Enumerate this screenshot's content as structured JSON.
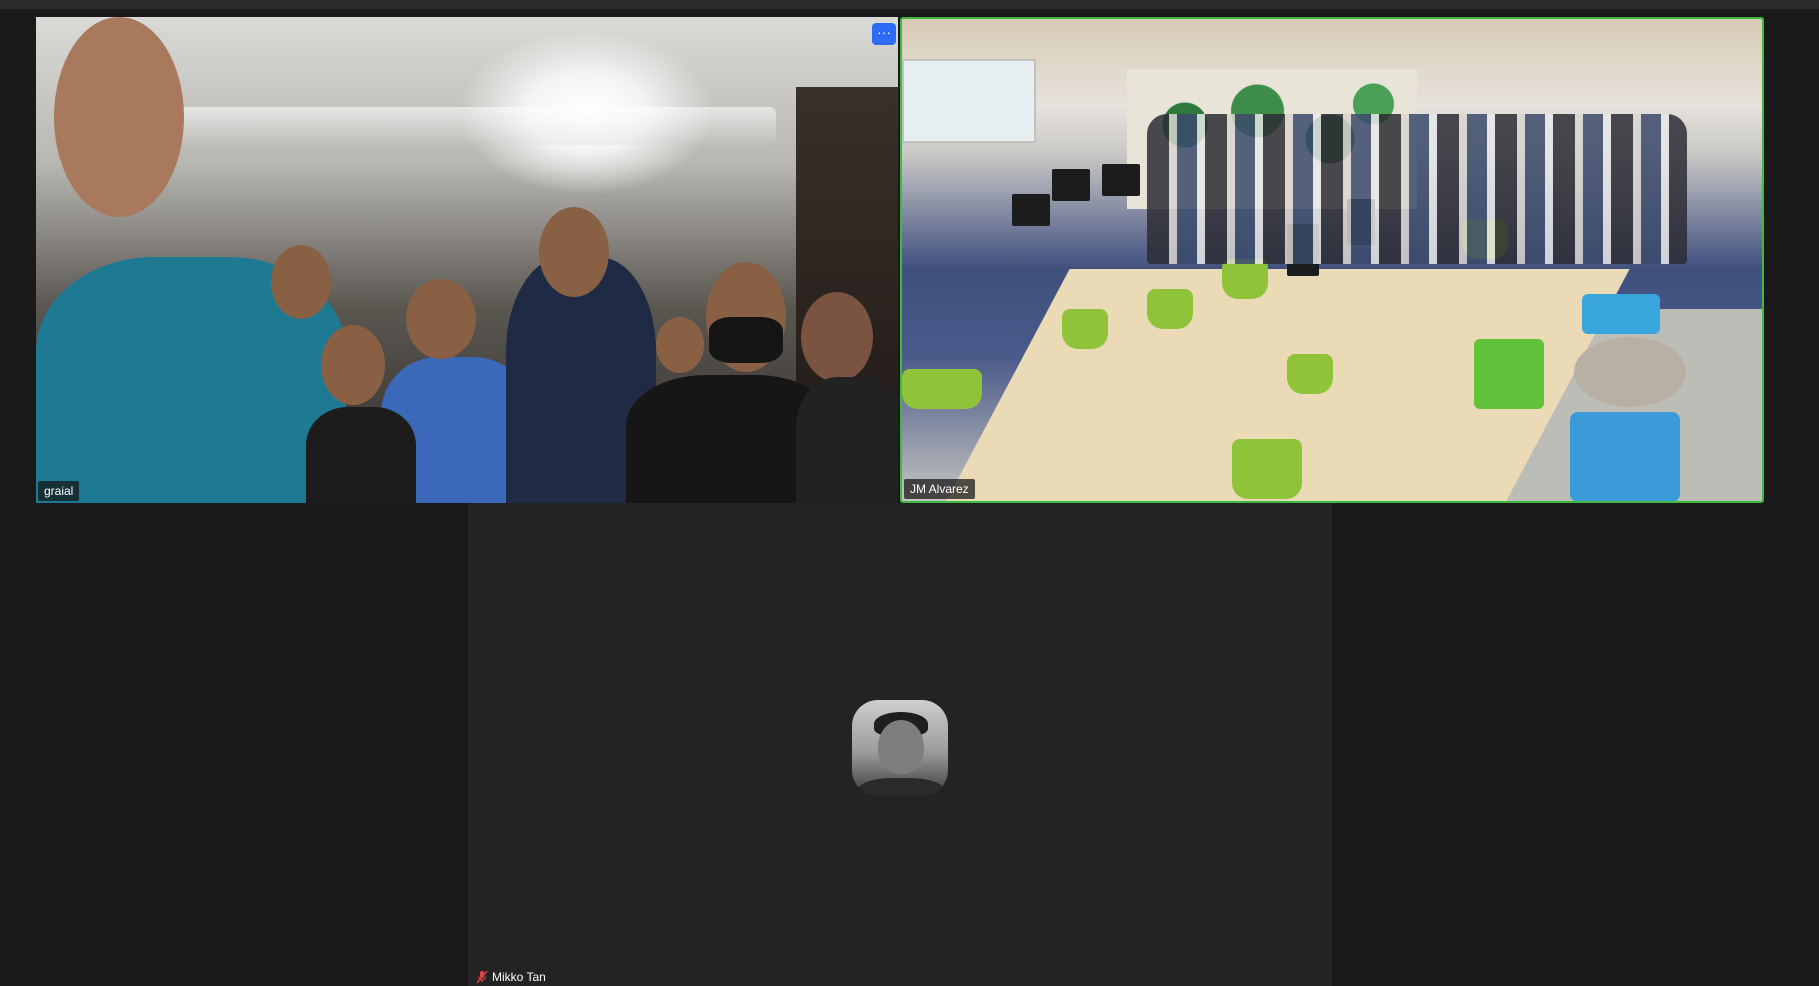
{
  "participants": [
    {
      "name": "graial",
      "has_video": true,
      "active_speaker": false,
      "muted": false
    },
    {
      "name": "JM Alvarez",
      "has_video": true,
      "active_speaker": true,
      "muted": false
    },
    {
      "name": "Mikko Tan",
      "has_video": false,
      "active_speaker": false,
      "muted": true
    }
  ],
  "controls": {
    "more_button_label": "···",
    "more_icon": "more-horizontal-icon"
  },
  "colors": {
    "background": "#1a1a1a",
    "active_speaker_border": "#3fb93f",
    "more_button": "#2d6df6",
    "muted_icon": "#e0443e"
  }
}
